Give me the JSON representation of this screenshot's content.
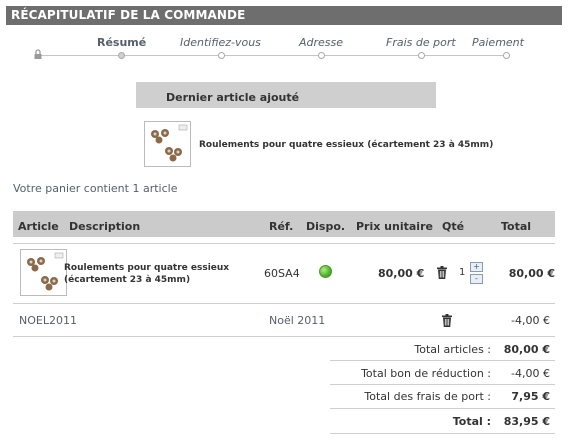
{
  "header": {
    "title": "RÉCAPITULATIF DE LA COMMANDE"
  },
  "steps": [
    {
      "label": "Résumé",
      "active": true
    },
    {
      "label": "Identifiez-vous",
      "active": false
    },
    {
      "label": "Adresse",
      "active": false
    },
    {
      "label": "Frais de port",
      "active": false
    },
    {
      "label": "Paiement",
      "active": false
    }
  ],
  "last_added": {
    "title": "Dernier article ajouté",
    "product_name": "Roulements pour quatre essieux (écartement 23 à 45mm)"
  },
  "cart_summary": "Votre panier contient 1 article",
  "table": {
    "headers": {
      "article": "Article",
      "description": "Description",
      "ref": "Réf.",
      "dispo": "Dispo.",
      "unit_price": "Prix unitaire",
      "qty": "Qté",
      "total": "Total"
    },
    "product": {
      "description_line1": "Roulements pour quatre essieux",
      "description_line2": "(écartement 23 à 45mm)",
      "ref": "60SA4",
      "availability": "in-stock",
      "unit_price": "80,00 €",
      "qty": "1",
      "total": "80,00 €"
    },
    "discount": {
      "code": "NOEL2011",
      "name": "Noël 2011",
      "total": "-4,00 €"
    }
  },
  "totals": {
    "articles": {
      "label": "Total articles :",
      "value": "80,00 €"
    },
    "discount": {
      "label": "Total bon de réduction :",
      "value": "-4,00 €"
    },
    "shipping": {
      "label": "Total des frais de port :",
      "value": "7,95 €"
    },
    "grand": {
      "label": "Total :",
      "value": "83,95 €"
    }
  },
  "colors": {
    "header_bg": "#6e6e6e",
    "table_head_bg": "#cbcbcb",
    "available": "#55b630"
  },
  "icons": {
    "lock": "lock-icon",
    "trash": "trash-icon",
    "qty_up": "+",
    "qty_down": "-"
  }
}
